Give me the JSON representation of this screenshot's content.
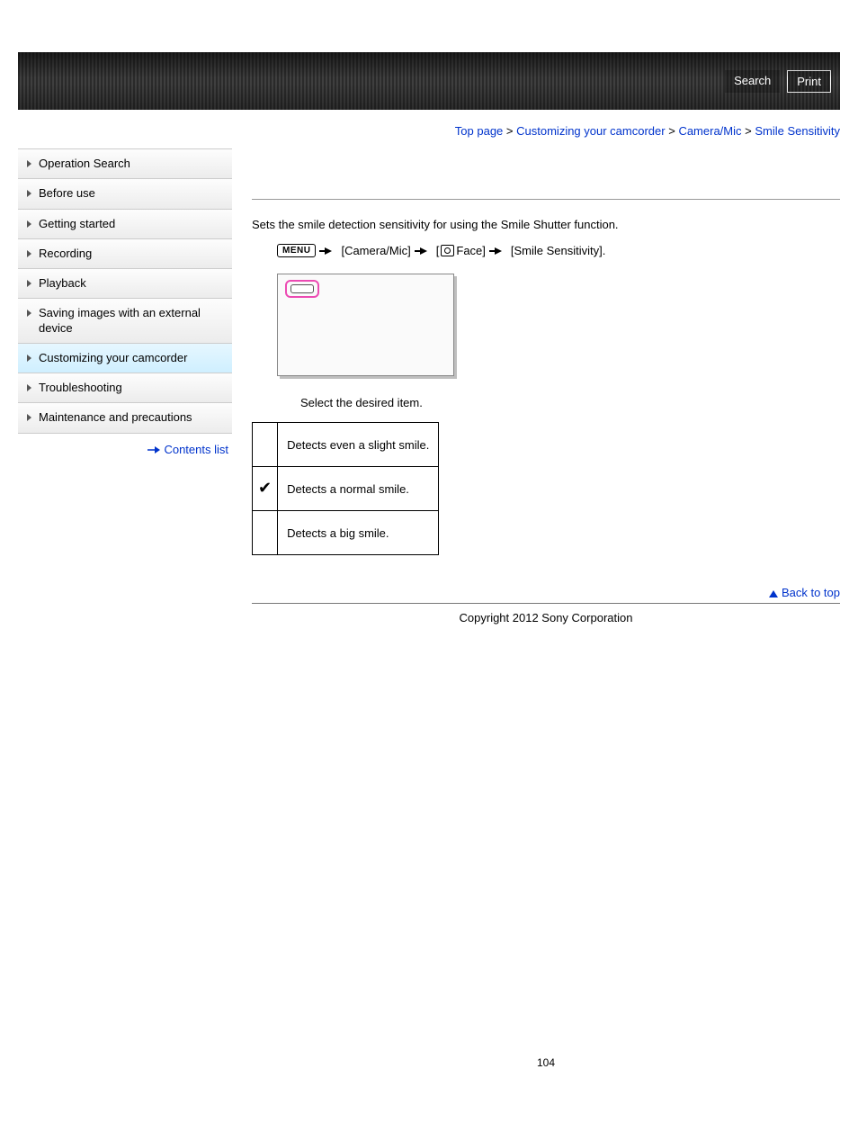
{
  "banner": {
    "search_label": "Search",
    "print_label": "Print"
  },
  "breadcrumb": {
    "top": "Top page",
    "custom": "Customizing your camcorder",
    "cammic": "Camera/Mic",
    "current": "Smile Sensitivity"
  },
  "sidebar": {
    "items": [
      {
        "label": "Operation Search"
      },
      {
        "label": "Before use"
      },
      {
        "label": "Getting started"
      },
      {
        "label": "Recording"
      },
      {
        "label": "Playback"
      },
      {
        "label": "Saving images with an external device"
      },
      {
        "label": "Customizing your camcorder",
        "active": true
      },
      {
        "label": "Troubleshooting"
      },
      {
        "label": "Maintenance and precautions"
      }
    ],
    "contents_label": "Contents list"
  },
  "content": {
    "intro": "Sets the smile detection sensitivity for using the Smile Shutter function.",
    "menu_text": "MENU",
    "path_cammic": "[Camera/Mic]",
    "path_face": "Face]",
    "path_smile": "[Smile Sensitivity].",
    "step": "Select the desired item.",
    "options": [
      {
        "mark": "",
        "text": "Detects even a slight smile."
      },
      {
        "mark": "✔",
        "text": "Detects a normal smile."
      },
      {
        "mark": "",
        "text": "Detects a big smile."
      }
    ],
    "back_label": "Back to top",
    "copyright": "Copyright 2012 Sony Corporation",
    "page_number": "104"
  }
}
